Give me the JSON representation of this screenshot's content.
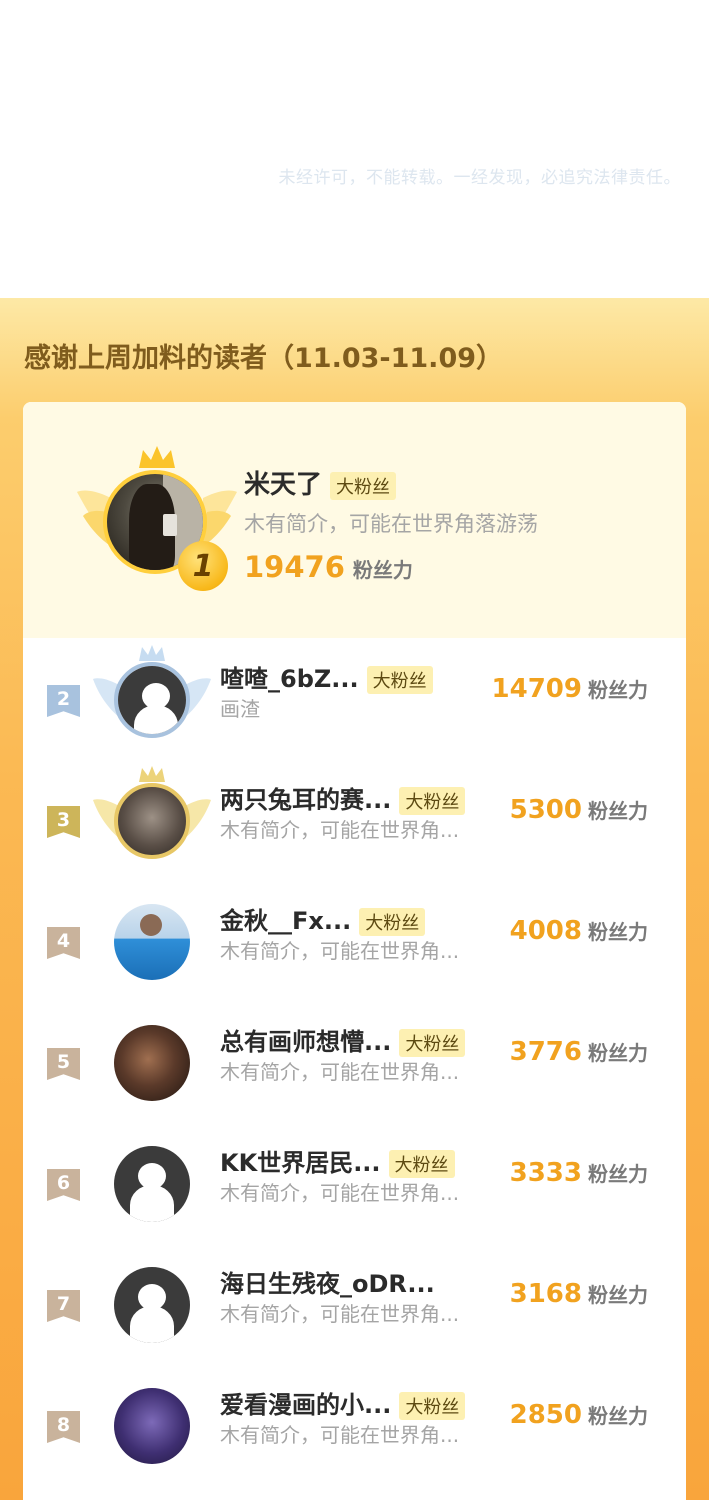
{
  "copyright": "未经许可，不能转载。一经发现，必追究法律责任。",
  "section_title": "感谢上周加料的读者（11.03-11.09）",
  "score_unit": "粉丝力",
  "fan_tag": "大粉丝",
  "colors": {
    "rank2": "#a8c2de",
    "rank3": "#cdb55a",
    "rank_other": "#c9b39c",
    "score": "#f1a21f"
  },
  "top1": {
    "rank": "1",
    "name": "米天了",
    "tag": "大粉丝",
    "bio": "木有简介，可能在世界角落游荡",
    "score": "19476"
  },
  "rows": [
    {
      "rank": "2",
      "name": "喳喳_6bZ...",
      "tag": "大粉丝",
      "bio": "画渣",
      "score": "14709"
    },
    {
      "rank": "3",
      "name": "两只兔耳的赛...",
      "tag": "大粉丝",
      "bio": "木有简介，可能在世界角...",
      "score": "5300"
    },
    {
      "rank": "4",
      "name": "金秋__Fx...",
      "tag": "大粉丝",
      "bio": "木有简介，可能在世界角...",
      "score": "4008"
    },
    {
      "rank": "5",
      "name": "总有画师想懵...",
      "tag": "大粉丝",
      "bio": "木有简介，可能在世界角...",
      "score": "3776"
    },
    {
      "rank": "6",
      "name": "KK世界居民...",
      "tag": "大粉丝",
      "bio": "木有简介，可能在世界角...",
      "score": "3333"
    },
    {
      "rank": "7",
      "name": "海日生残夜_oDR...",
      "tag": "",
      "bio": "木有简介，可能在世界角...",
      "score": "3168"
    },
    {
      "rank": "8",
      "name": "爱看漫画的小...",
      "tag": "大粉丝",
      "bio": "木有简介，可能在世界角...",
      "score": "2850"
    }
  ]
}
